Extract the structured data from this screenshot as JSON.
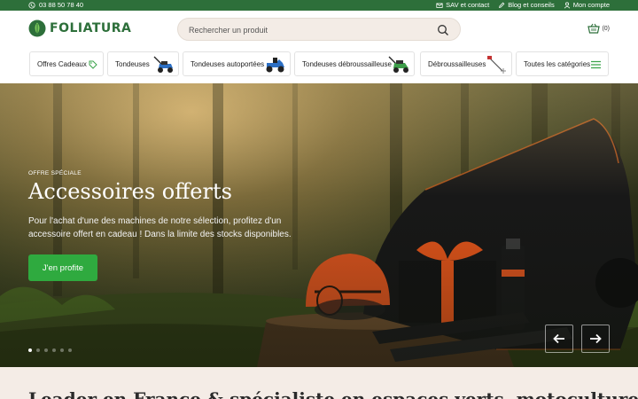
{
  "topbar": {
    "phone": "03 88 50 78 40",
    "links": [
      {
        "label": "SAV et contact",
        "icon": "mail-icon"
      },
      {
        "label": "Blog et conseils",
        "icon": "pen-icon"
      },
      {
        "label": "Mon compte",
        "icon": "user-icon"
      }
    ]
  },
  "header": {
    "logo": "FOLIATURA",
    "search_placeholder": "Rechercher un produit",
    "cart_count": "(0)"
  },
  "nav": {
    "items": [
      {
        "label": "Offres Cadeaux",
        "icon": "tag-icon"
      },
      {
        "label": "Tondeuses",
        "icon": "lawnmower-thumb"
      },
      {
        "label": "Tondeuses autoportées",
        "icon": "ride-on-mower-thumb"
      },
      {
        "label": "Tondeuses débroussailleuse",
        "icon": "brush-mower-thumb"
      },
      {
        "label": "Débroussailleuses",
        "icon": "brushcutter-thumb"
      },
      {
        "label": "Toutes les catégories",
        "icon": "hamburger-icon"
      }
    ]
  },
  "hero": {
    "overline": "OFFRE SPÉCIALE",
    "title": "Accessoires offerts",
    "text": "Pour l'achat d'une des machines de notre sélection, profitez d'un accessoire offert en cadeau ! Dans la limite des stocks disponibles.",
    "cta": "J'en profite",
    "slides_total": 6,
    "active_slide": 1
  },
  "section": {
    "heading": "Leader en France & spécialiste en espaces verts, motoculture"
  },
  "colors": {
    "brand_green": "#2d6f3a",
    "cta_green": "#2faa3f",
    "search_bg": "#f3ece6"
  }
}
